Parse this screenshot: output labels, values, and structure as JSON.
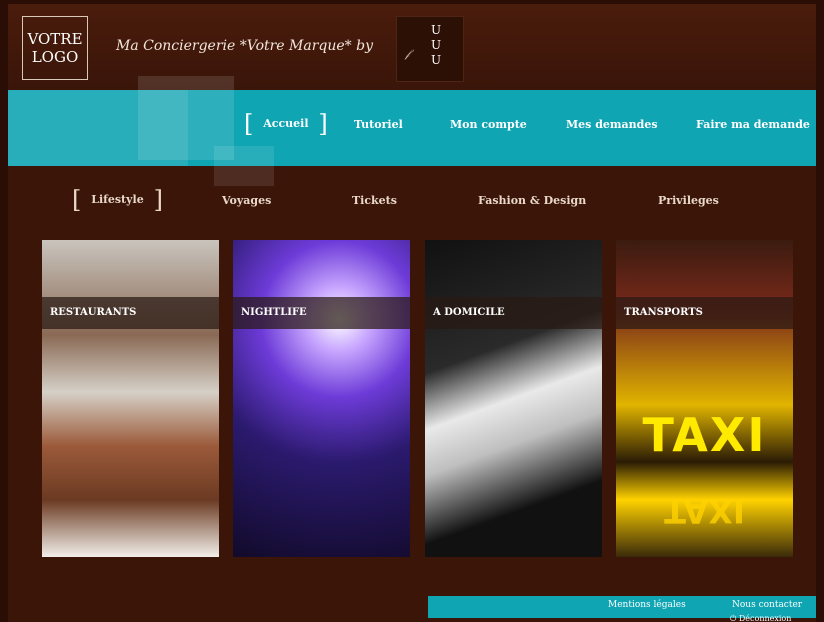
{
  "header": {
    "logo_line1": "VOTRE",
    "logo_line2": "LOGO",
    "brand_text": "Ma Conciergerie *Votre Marque* by",
    "partner_letters": [
      "U",
      "U",
      "U"
    ]
  },
  "nav": {
    "items": [
      "Accueil",
      "Tutoriel",
      "Mon compte",
      "Mes demandes",
      "Faire ma demande"
    ],
    "active": "Accueil"
  },
  "categories": {
    "items": [
      "Lifestyle",
      "Voyages",
      "Tickets",
      "Fashion & Design",
      "Privileges"
    ],
    "active": "Lifestyle"
  },
  "tiles": [
    {
      "label": "RESTAURANTS"
    },
    {
      "label": "NIGHTLIFE"
    },
    {
      "label": "A DOMICILE"
    },
    {
      "label": "TRANSPORTS",
      "image_text": "TAXI"
    }
  ],
  "footer": {
    "legal": "Mentions légales",
    "contact": "Nous contacter",
    "logout": "Déconnexion"
  },
  "colors": {
    "accent": "#10a5b3",
    "background": "#3a1508"
  }
}
